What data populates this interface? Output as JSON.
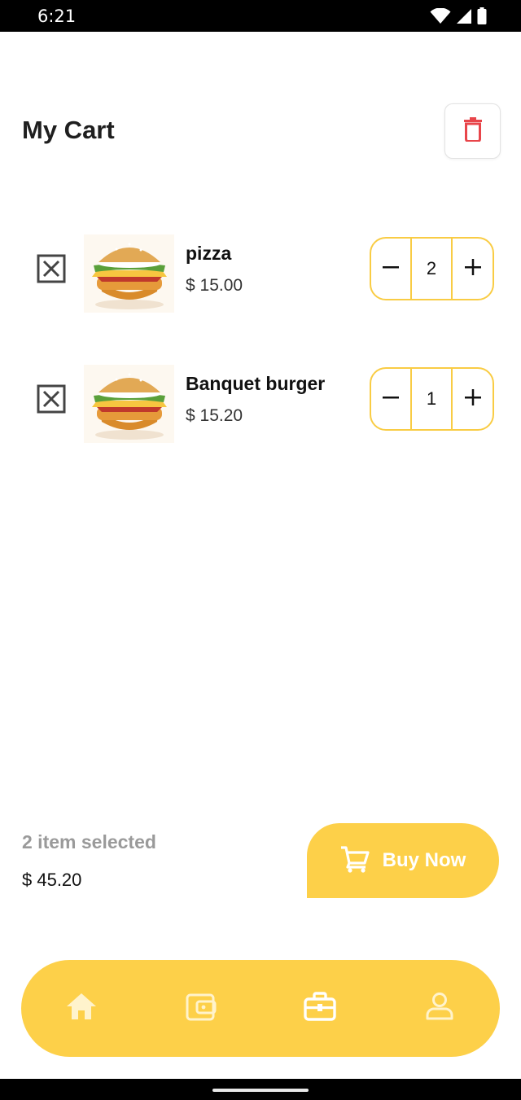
{
  "status_bar": {
    "time": "6:21",
    "icons": [
      "wifi-icon",
      "signal-icon",
      "battery-icon"
    ]
  },
  "header": {
    "title": "My Cart",
    "action_icon": "trash-icon"
  },
  "cart": {
    "items": [
      {
        "name": "pizza",
        "price": "$ 15.00",
        "quantity": "2",
        "image": "burger-image"
      },
      {
        "name": "Banquet burger",
        "price": "$ 15.20",
        "quantity": "1",
        "image": "burger-image"
      }
    ]
  },
  "summary": {
    "selected": "2 item selected",
    "total": "$ 45.20",
    "buy_label": "Buy Now"
  },
  "bottom_nav": {
    "items": [
      {
        "icon": "home-icon",
        "active": false
      },
      {
        "icon": "wallet-icon",
        "active": false
      },
      {
        "icon": "briefcase-icon",
        "active": true
      },
      {
        "icon": "profile-icon",
        "active": false
      }
    ]
  },
  "colors": {
    "accent": "#fdd049",
    "stepper_border": "#f9cc44",
    "trash": "#e8454a",
    "nav_inactive": "#fff3cc",
    "nav_active": "#ffffff"
  }
}
